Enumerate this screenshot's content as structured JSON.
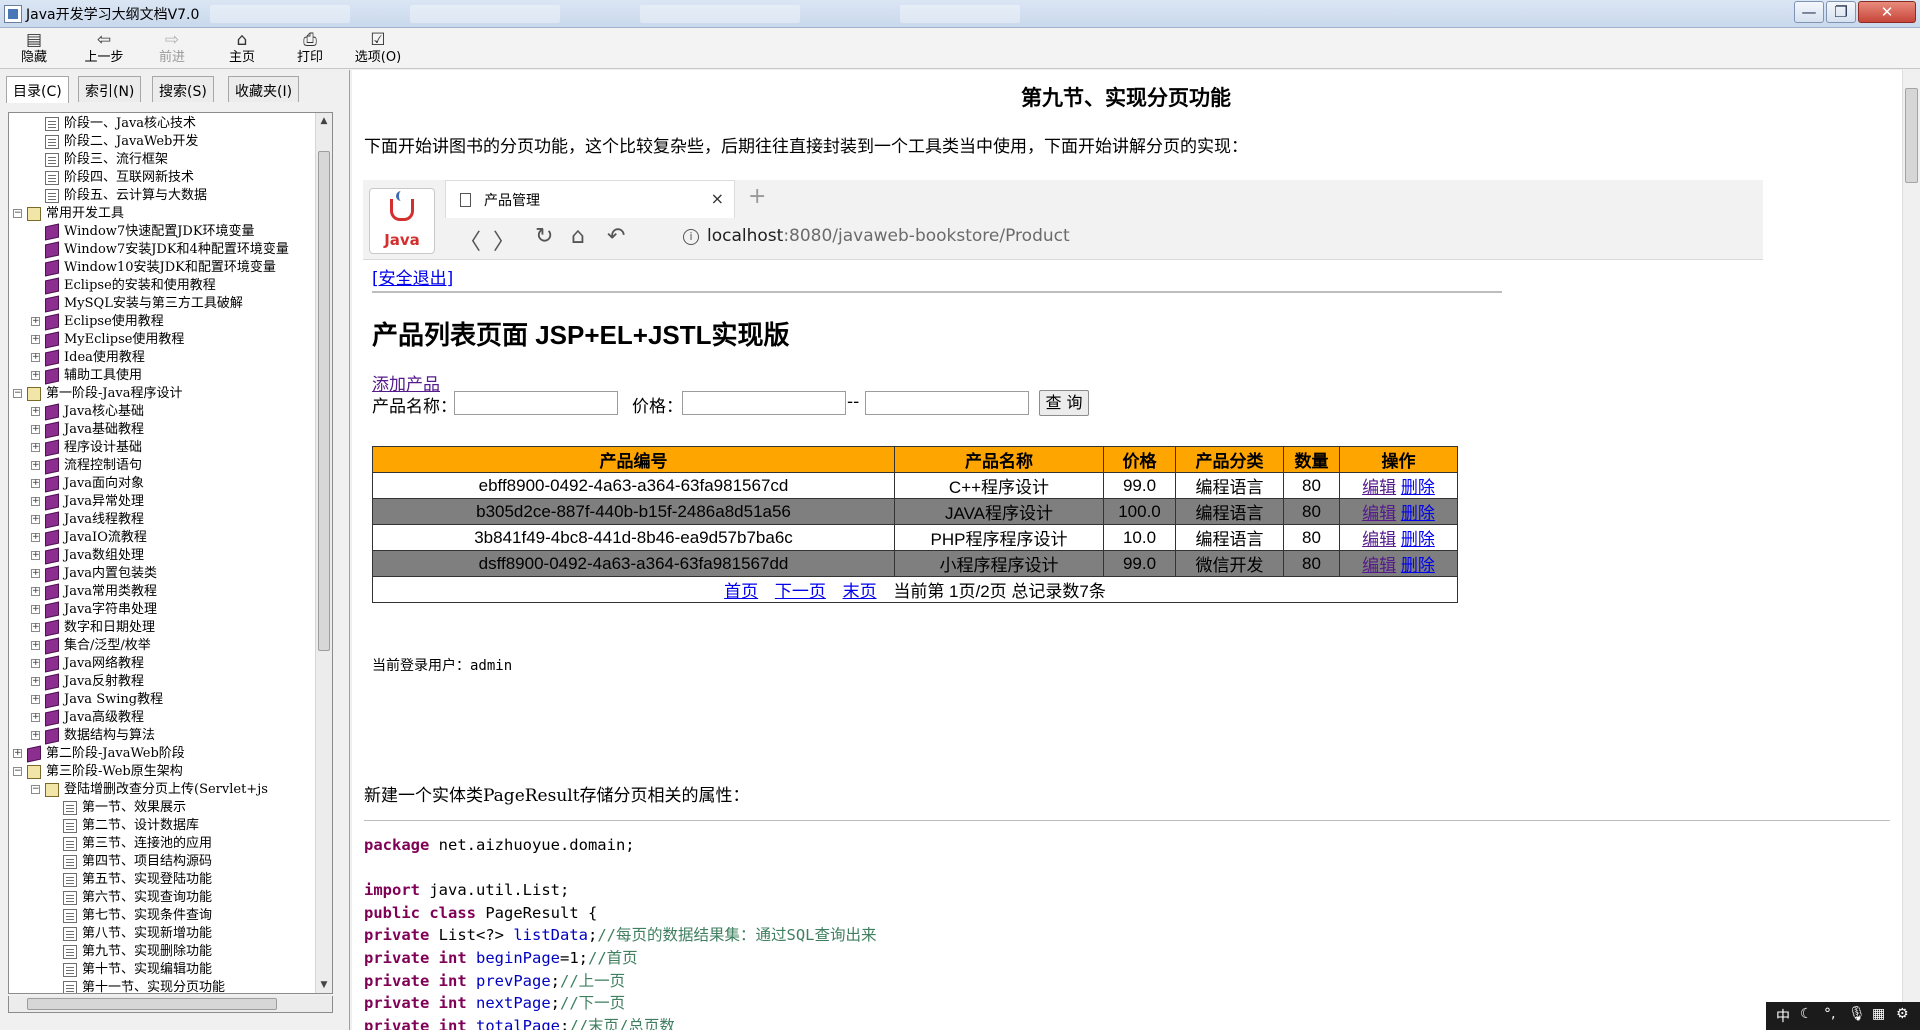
{
  "window": {
    "title": "Java开发学习大纲文档V7.0",
    "min_glyph": "—",
    "max_glyph": "❐",
    "close_glyph": "✕"
  },
  "toolbar": [
    {
      "label": "隐藏",
      "icon": "▤",
      "enabled": true
    },
    {
      "label": "上一步",
      "icon": "⇦",
      "enabled": true
    },
    {
      "label": "前进",
      "icon": "⇨",
      "enabled": false
    },
    {
      "label": "主页",
      "icon": "⌂",
      "enabled": true
    },
    {
      "label": "打印",
      "icon": "⎙",
      "enabled": true
    },
    {
      "label": "选项(O)",
      "icon": "☑",
      "enabled": true
    }
  ],
  "left_tabs": [
    "目录(C)",
    "索引(N)",
    "搜索(S)",
    "收藏夹(I)"
  ],
  "tree": [
    {
      "label": "阶段一、Java核心技术",
      "indent": 2,
      "icon": "page",
      "exp": ""
    },
    {
      "label": "阶段二、JavaWeb开发",
      "indent": 2,
      "icon": "page",
      "exp": ""
    },
    {
      "label": "阶段三、流行框架",
      "indent": 2,
      "icon": "page",
      "exp": ""
    },
    {
      "label": "阶段四、互联网新技术",
      "indent": 2,
      "icon": "page",
      "exp": ""
    },
    {
      "label": "阶段五、云计算与大数据",
      "indent": 2,
      "icon": "page",
      "exp": ""
    },
    {
      "label": "常用开发工具",
      "indent": 1,
      "icon": "bookopen",
      "exp": "−"
    },
    {
      "label": "Window7快速配置JDK环境变量",
      "indent": 2,
      "icon": "book",
      "exp": ""
    },
    {
      "label": "Window7安装JDK和4种配置环境变量",
      "indent": 2,
      "icon": "book",
      "exp": ""
    },
    {
      "label": "Window10安装JDK和配置环境变量",
      "indent": 2,
      "icon": "book",
      "exp": ""
    },
    {
      "label": "Eclipse的安装和使用教程",
      "indent": 2,
      "icon": "book",
      "exp": ""
    },
    {
      "label": "MySQL安装与第三方工具破解",
      "indent": 2,
      "icon": "book",
      "exp": ""
    },
    {
      "label": "Eclipse使用教程",
      "indent": 2,
      "icon": "book",
      "exp": "+"
    },
    {
      "label": "MyEclipse使用教程",
      "indent": 2,
      "icon": "book",
      "exp": "+"
    },
    {
      "label": "Idea使用教程",
      "indent": 2,
      "icon": "book",
      "exp": "+"
    },
    {
      "label": "辅助工具使用",
      "indent": 2,
      "icon": "book",
      "exp": "+"
    },
    {
      "label": "第一阶段-Java程序设计",
      "indent": 1,
      "icon": "bookopen",
      "exp": "−"
    },
    {
      "label": "Java核心基础",
      "indent": 2,
      "icon": "book",
      "exp": "+"
    },
    {
      "label": "Java基础教程",
      "indent": 2,
      "icon": "book",
      "exp": "+"
    },
    {
      "label": "程序设计基础",
      "indent": 2,
      "icon": "book",
      "exp": "+"
    },
    {
      "label": "流程控制语句",
      "indent": 2,
      "icon": "book",
      "exp": "+"
    },
    {
      "label": "Java面向对象",
      "indent": 2,
      "icon": "book",
      "exp": "+"
    },
    {
      "label": "Java异常处理",
      "indent": 2,
      "icon": "book",
      "exp": "+"
    },
    {
      "label": "Java线程教程",
      "indent": 2,
      "icon": "book",
      "exp": "+"
    },
    {
      "label": "JavaIO流教程",
      "indent": 2,
      "icon": "book",
      "exp": "+"
    },
    {
      "label": "Java数组处理",
      "indent": 2,
      "icon": "book",
      "exp": "+"
    },
    {
      "label": "Java内置包装类",
      "indent": 2,
      "icon": "book",
      "exp": "+"
    },
    {
      "label": "Java常用类教程",
      "indent": 2,
      "icon": "book",
      "exp": "+"
    },
    {
      "label": "Java字符串处理",
      "indent": 2,
      "icon": "book",
      "exp": "+"
    },
    {
      "label": "数字和日期处理",
      "indent": 2,
      "icon": "book",
      "exp": "+"
    },
    {
      "label": "集合/泛型/枚举",
      "indent": 2,
      "icon": "book",
      "exp": "+"
    },
    {
      "label": "Java网络教程",
      "indent": 2,
      "icon": "book",
      "exp": "+"
    },
    {
      "label": "Java反射教程",
      "indent": 2,
      "icon": "book",
      "exp": "+"
    },
    {
      "label": "Java Swing教程",
      "indent": 2,
      "icon": "book",
      "exp": "+"
    },
    {
      "label": "Java高级教程",
      "indent": 2,
      "icon": "book",
      "exp": "+"
    },
    {
      "label": "数据结构与算法",
      "indent": 2,
      "icon": "book",
      "exp": "+"
    },
    {
      "label": "第二阶段-JavaWeb阶段",
      "indent": 1,
      "icon": "book",
      "exp": "+"
    },
    {
      "label": "第三阶段-Web原生架构",
      "indent": 1,
      "icon": "bookopen",
      "exp": "−"
    },
    {
      "label": "登陆增删改查分页上传(Servlet+js",
      "indent": 2,
      "icon": "bookopen",
      "exp": "−"
    },
    {
      "label": "第一节、效果展示",
      "indent": 3,
      "icon": "page",
      "exp": ""
    },
    {
      "label": "第二节、设计数据库",
      "indent": 3,
      "icon": "page",
      "exp": ""
    },
    {
      "label": "第三节、连接池的应用",
      "indent": 3,
      "icon": "page",
      "exp": ""
    },
    {
      "label": "第四节、项目结构源码",
      "indent": 3,
      "icon": "page",
      "exp": ""
    },
    {
      "label": "第五节、实现登陆功能",
      "indent": 3,
      "icon": "page",
      "exp": ""
    },
    {
      "label": "第六节、实现查询功能",
      "indent": 3,
      "icon": "page",
      "exp": ""
    },
    {
      "label": "第七节、实现条件查询",
      "indent": 3,
      "icon": "page",
      "exp": ""
    },
    {
      "label": "第八节、实现新增功能",
      "indent": 3,
      "icon": "page",
      "exp": ""
    },
    {
      "label": "第九节、实现删除功能",
      "indent": 3,
      "icon": "page",
      "exp": ""
    },
    {
      "label": "第十节、实现编辑功能",
      "indent": 3,
      "icon": "page",
      "exp": ""
    },
    {
      "label": "第十一节、实现分页功能",
      "indent": 3,
      "icon": "page",
      "exp": ""
    }
  ],
  "article": {
    "heading": "第九节、实现分页功能",
    "intro": "下面开始讲图书的分页功能，这个比较复杂些，后期往往直接封装到一个工具类当中使用，下面开始讲解分页的实现：",
    "note": "新建一个实体类PageResult存储分页相关的属性："
  },
  "browser": {
    "logo_text": "Java",
    "tab_title": "产品管理",
    "tab_close": "×",
    "new_tab": "+",
    "url_host": "localhost",
    "url_rest": ":8080/javaweb-bookstore/Product"
  },
  "webpage": {
    "logout": "[安全退出]",
    "title": "产品列表页面 JSP+EL+JSTL实现版",
    "add_link": "添加产品",
    "search": {
      "name_label": "产品名称：",
      "price_label": "价格：",
      "dash": "--",
      "button": "查 询"
    },
    "table": {
      "headers": [
        "产品编号",
        "产品名称",
        "价格",
        "产品分类",
        "数量",
        "操作"
      ],
      "rows": [
        {
          "id": "ebff8900-0492-4a63-a364-63fa981567cd",
          "name": "C++程序设计",
          "price": "99.0",
          "category": "编程语言",
          "qty": "80",
          "edit": "编辑",
          "del": "删除"
        },
        {
          "id": "b305d2ce-887f-440b-b15f-2486a8d51a56",
          "name": "JAVA程序设计",
          "price": "100.0",
          "category": "编程语言",
          "qty": "80",
          "edit": "编辑",
          "del": "删除"
        },
        {
          "id": "3b841f49-4bc8-441d-8b46-ea9d57b7ba6c",
          "name": "PHP程序程序设计",
          "price": "10.0",
          "category": "编程语言",
          "qty": "80",
          "edit": "编辑",
          "del": "删除"
        },
        {
          "id": "dsff8900-0492-4a63-a364-63fa981567dd",
          "name": "小程序程序设计",
          "price": "99.0",
          "category": "微信开发",
          "qty": "80",
          "edit": "编辑",
          "del": "删除"
        }
      ],
      "pager": {
        "first": "首页",
        "next": "下一页",
        "last": "末页",
        "info": "当前第 1页/2页 总记录数7条"
      }
    },
    "current_user": "当前登录用户：admin"
  },
  "code_lines": [
    [
      [
        "kw",
        "package"
      ],
      [
        "t",
        " net.aizhuoyue.domain;"
      ]
    ],
    [],
    [
      [
        "kw",
        "import"
      ],
      [
        "t",
        " java.util.List;"
      ]
    ],
    [
      [
        "kw",
        "public"
      ],
      [
        "t",
        " "
      ],
      [
        "kw",
        "class"
      ],
      [
        "t",
        " PageResult {"
      ]
    ],
    [
      [
        "kw",
        "private"
      ],
      [
        "t",
        " List<?> "
      ],
      [
        "fld",
        "listData"
      ],
      [
        "t",
        ";"
      ],
      [
        "cm",
        "//每页的数据结果集：通过SQL查询出来"
      ]
    ],
    [
      [
        "kw",
        "private"
      ],
      [
        "t",
        " "
      ],
      [
        "kw",
        "int"
      ],
      [
        "t",
        " "
      ],
      [
        "fld",
        "beginPage"
      ],
      [
        "t",
        "=1;"
      ],
      [
        "cm",
        "//首页"
      ]
    ],
    [
      [
        "kw",
        "private"
      ],
      [
        "t",
        " "
      ],
      [
        "kw",
        "int"
      ],
      [
        "t",
        " "
      ],
      [
        "fld",
        "prevPage"
      ],
      [
        "t",
        ";"
      ],
      [
        "cm",
        "//上一页"
      ]
    ],
    [
      [
        "kw",
        "private"
      ],
      [
        "t",
        " "
      ],
      [
        "kw",
        "int"
      ],
      [
        "t",
        " "
      ],
      [
        "fld",
        "nextPage"
      ],
      [
        "t",
        ";"
      ],
      [
        "cm",
        "//下一页"
      ]
    ],
    [
      [
        "kw",
        "private"
      ],
      [
        "t",
        " "
      ],
      [
        "kw",
        "int"
      ],
      [
        "t",
        " "
      ],
      [
        "fld",
        "totalPage"
      ],
      [
        "t",
        ";"
      ],
      [
        "cm",
        "//末页/总页数"
      ]
    ]
  ],
  "tray": [
    "中",
    "☾",
    "°,",
    "🎙",
    "▦",
    "⚙"
  ],
  "colors": {
    "table_header": "#ffa500",
    "row_alt": "#7f7f7f",
    "link": "#0000ee",
    "visited": "#551a8b"
  }
}
